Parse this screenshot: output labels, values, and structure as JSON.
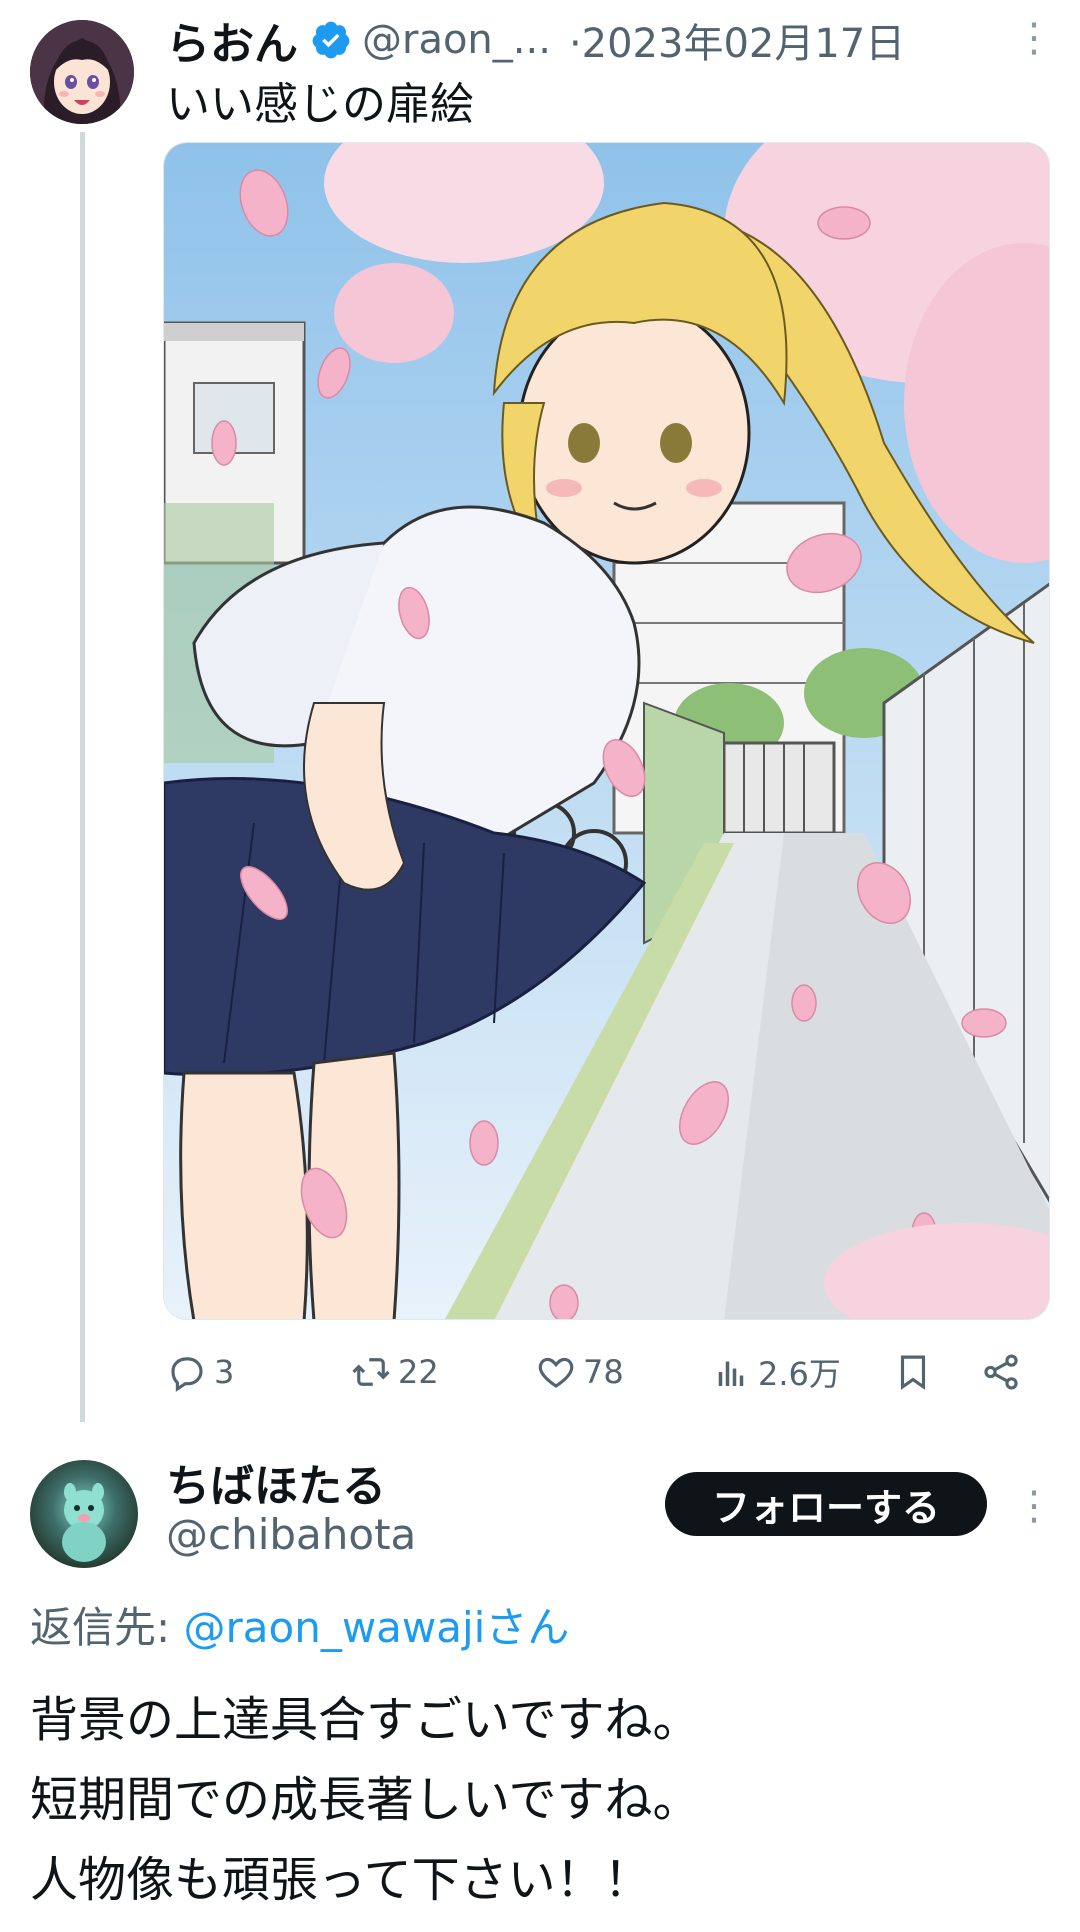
{
  "tweet": {
    "author": {
      "display_name": "らおん",
      "handle": "@raon_...",
      "verified": true,
      "avatar_icon": "user-avatar-anime-girl"
    },
    "date": "·2023年02月17日",
    "text": "いい感じの扉絵",
    "media_icon": "manga-illustration-girl-cherry-blossoms",
    "actions": {
      "reply_count": "3",
      "retweet_count": "22",
      "like_count": "78",
      "views_count": "2.6万"
    }
  },
  "reply": {
    "author": {
      "display_name": "ちばほたる",
      "handle": "@chibahota",
      "avatar_icon": "user-avatar-figure"
    },
    "follow_label": "フォローする",
    "reply_to_prefix": "返信先: ",
    "reply_to_mention": "@raon_wawaji",
    "reply_to_suffix": "さん",
    "lines": [
      "背景の上達具合すごいですね。",
      "短期間での成長著しいですね。",
      "人物像も頑張って下さい！！"
    ]
  },
  "colors": {
    "accent": "#1d9bf0",
    "text": "#0f1419",
    "secondary": "#536471",
    "follow_button": "#0f1419"
  }
}
